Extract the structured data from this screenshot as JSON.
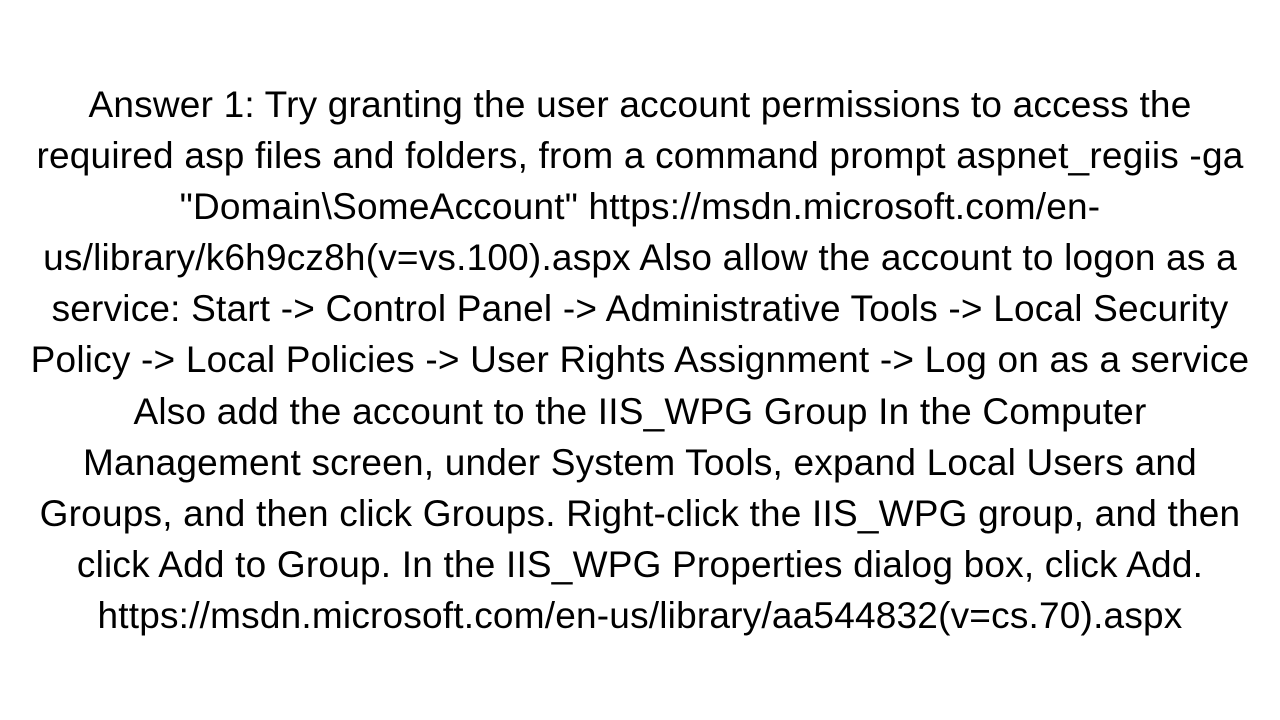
{
  "answer": {
    "text": "Answer 1: Try granting the user account permissions to access the required asp files and folders, from a command prompt aspnet_regiis -ga \"Domain\\SomeAccount\" https://msdn.microsoft.com/en-us/library/k6h9cz8h(v=vs.100).aspx Also allow the account to logon as a service: Start -> Control Panel -> Administrative Tools -> Local Security Policy -> Local Policies -> User Rights Assignment -> Log on as a service Also add the account to the IIS_WPG Group In the Computer Management screen, under System Tools, expand Local Users and Groups, and then click Groups. Right-click the IIS_WPG group, and then click Add to Group. In the IIS_WPG Properties dialog box, click Add. https://msdn.microsoft.com/en-us/library/aa544832(v=cs.70).aspx"
  }
}
